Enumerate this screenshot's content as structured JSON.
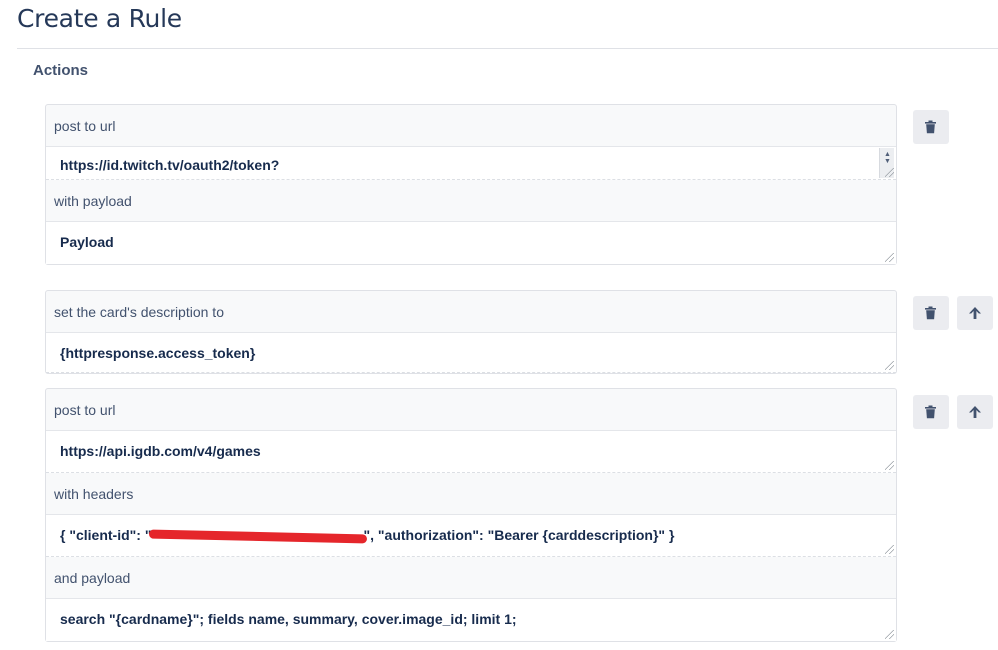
{
  "page": {
    "title": "Create a Rule"
  },
  "section": {
    "label": "Actions"
  },
  "actions": [
    {
      "fields": [
        {
          "label": "post to url",
          "value": "https://id.twitch.tv/oauth2/token?"
        },
        {
          "label": "with payload",
          "value": "Payload"
        }
      ],
      "buttons": [
        "trash-icon"
      ]
    },
    {
      "fields": [
        {
          "label": "set the card's description to",
          "value": "{httpresponse.access_token}"
        }
      ],
      "buttons": [
        "trash-icon",
        "arrow-up-icon"
      ]
    },
    {
      "fields": [
        {
          "label": "post to url",
          "value": "https://api.igdb.com/v4/games"
        },
        {
          "label": "with headers",
          "value_before": "{ \"client-id\": \"",
          "value_after": "\", \"authorization\": \"Bearer {carddescription}\" }"
        },
        {
          "label": "and payload",
          "value": "search \"{cardname}\"; fields name, summary, cover.image_id; limit 1;"
        }
      ],
      "buttons": [
        "trash-icon",
        "arrow-up-icon"
      ]
    }
  ],
  "colors": {
    "title": "#253858",
    "button_bg": "#ebecf0",
    "icon": "#42526e",
    "redaction": "#e5262b"
  }
}
